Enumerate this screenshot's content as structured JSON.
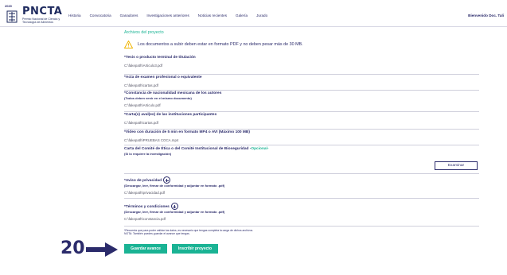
{
  "header": {
    "logo_year": "2020",
    "logo_text": "PNCTA",
    "logo_sub": "Premio Nacional de Ciencia y Tecnología de Alimentos",
    "nav": [
      "Historia",
      "Convocatoria",
      "Ganadores",
      "Investigaciones anteriores",
      "Noticias recientes",
      "Galería",
      "Jurado"
    ],
    "user": "Bienvenido Doc. Tali"
  },
  "section": {
    "title": "Archivos del proyecto",
    "warning": "Los documentos a subir deben estar en formato PDF y no deben pesar más de 30 MB."
  },
  "fields": [
    {
      "label": "*Tesis o producto terminal de titulación",
      "note": "",
      "value": "C:\\fakepath\\Articulo3.pdf"
    },
    {
      "label": "*Acta de examen profesional o equivalente",
      "note": "",
      "value": "C:\\fakepath\\cartas.pdf"
    },
    {
      "label": "*Constancia de nacionalidad mexicana de los autores",
      "note": "(Todos deben venir en el mismo documento)",
      "value": "C:\\fakepath\\Articulo.pdf"
    },
    {
      "label": "*Carta(s) aval(es) de las instituciones participantes",
      "note": "",
      "value": "C:\\fakepath\\cartas.pdf"
    },
    {
      "label": "*Video con duración de 5 min en formato MP4 o AVI (Máximo 100 MB)",
      "note": "",
      "value": "C:\\fakepath\\PRUEBAS COCA.mp4"
    }
  ],
  "ethics": {
    "label": "Carta del Comité de Ética o del Comité Institucional de Bioseguridad -",
    "optional": "Opcional-",
    "note": "(Si lo requiere la investigación)",
    "button": "Examinar"
  },
  "privacy": {
    "label": "*Aviso de privacidad",
    "note": "(Descargar, leer, firmar de conformidad y adjuntar en formato .pdf)",
    "value": "C:\\fakepath\\privacidad.pdf"
  },
  "terms": {
    "label": "*Términos y condiciones",
    "note": "(Descargar, leer, firmar de conformidad y adjuntar en formato .pdf)",
    "value": "C:\\fakepath\\constancia.pdf"
  },
  "footer": {
    "note1": "*Recuerda que para poder validar tus datos, es necesario que tengas completa la carga de dichos archivos.",
    "note2": "NOTA: También puedes guardar el avance que tengas.",
    "save": "Guardar avance",
    "register": "Inscribir proyecto"
  },
  "annotation": {
    "step": "20"
  },
  "colors": {
    "accent": "#1ab394",
    "text": "#2b2b6b",
    "warning": "#f0b400"
  }
}
